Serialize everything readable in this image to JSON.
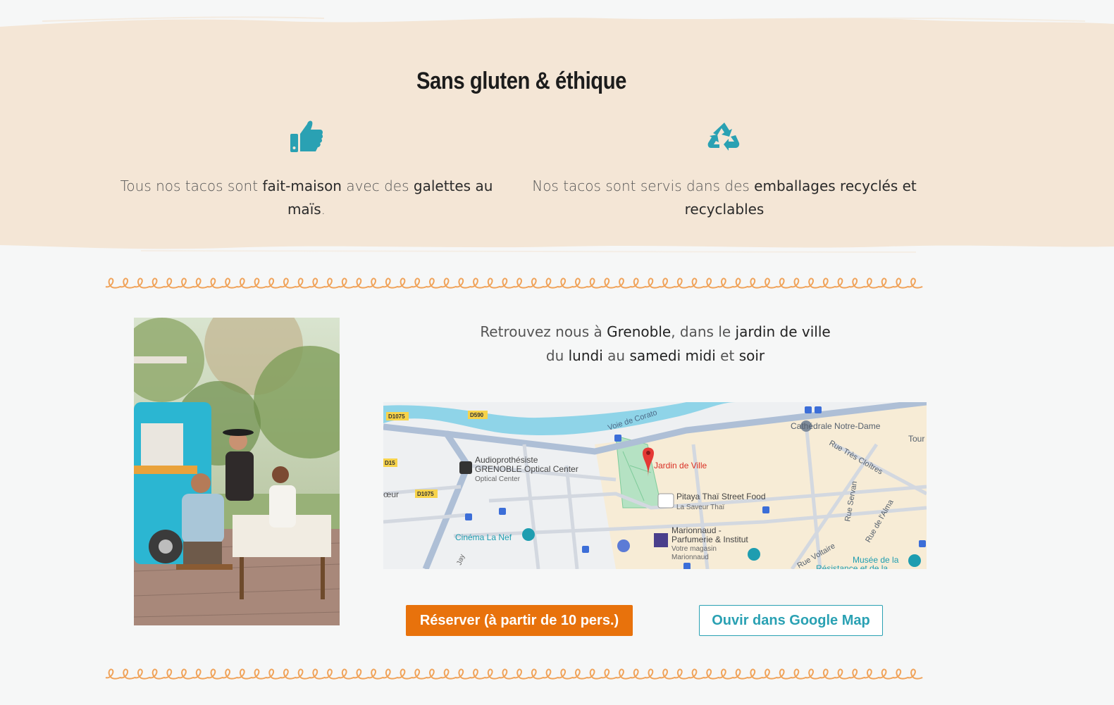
{
  "section": {
    "title": "Sans gluten & éthique",
    "colors": {
      "band": "#f4e6d6",
      "accent": "#f0a35a",
      "teal": "#2aa1b3",
      "orange": "#e8720c"
    }
  },
  "features": [
    {
      "icon": "thumbs-up-icon",
      "parts": [
        "Tous nos tacos sont ",
        "fait-maison",
        " avec des ",
        "galettes au maïs",
        "."
      ]
    },
    {
      "icon": "recycle-icon",
      "parts": [
        "Nos tacos sont servis dans des ",
        "emballages recyclés et recyclables"
      ]
    }
  ],
  "location": {
    "line1": [
      "Retrouvez nous à ",
      "Grenoble",
      ", dans le ",
      "jardin de ville"
    ],
    "line2": [
      "du ",
      "lundi",
      " au ",
      "samedi midi",
      " et ",
      "soir"
    ]
  },
  "map": {
    "labels": {
      "d1075_a": "D1075",
      "d590": "D590",
      "d15": "D15",
      "d1075_b": "D1075",
      "voie": "Voie de Corato",
      "cathedrale": "Cathédrale Notre-Dame",
      "tour": "Tour M",
      "rue_tres_cloitres": "Rue Très Cloîtres",
      "audio_1": "Audioprothésiste",
      "audio_2": "GRENOBLE Optical Center",
      "audio_3": "Optical Center",
      "jardin": "Jardin de Ville",
      "pitaya_1": "Pitaya Thaï Street Food",
      "pitaya_2": "La Saveur Thaï",
      "coeur": "œur",
      "rue_servan": "Rue Servan",
      "rue_alma": "Rue de l'Alma",
      "cinema": "Cinéma La Nef",
      "marionnaud_1": "Marionnaud -",
      "marionnaud_2": "Parfumerie & Institut",
      "marionnaud_3": "Votre magasin",
      "marionnaud_4": "Marionnaud",
      "rue_voltaire": "Rue Voltaire",
      "musee_1": "Musée de la",
      "musee_2": "Résistance et de la",
      "jay": "Jay"
    }
  },
  "buttons": {
    "reserve": "Réserver (à partir de 10 pers.)",
    "google_map": "Ouvir dans Google Map"
  }
}
